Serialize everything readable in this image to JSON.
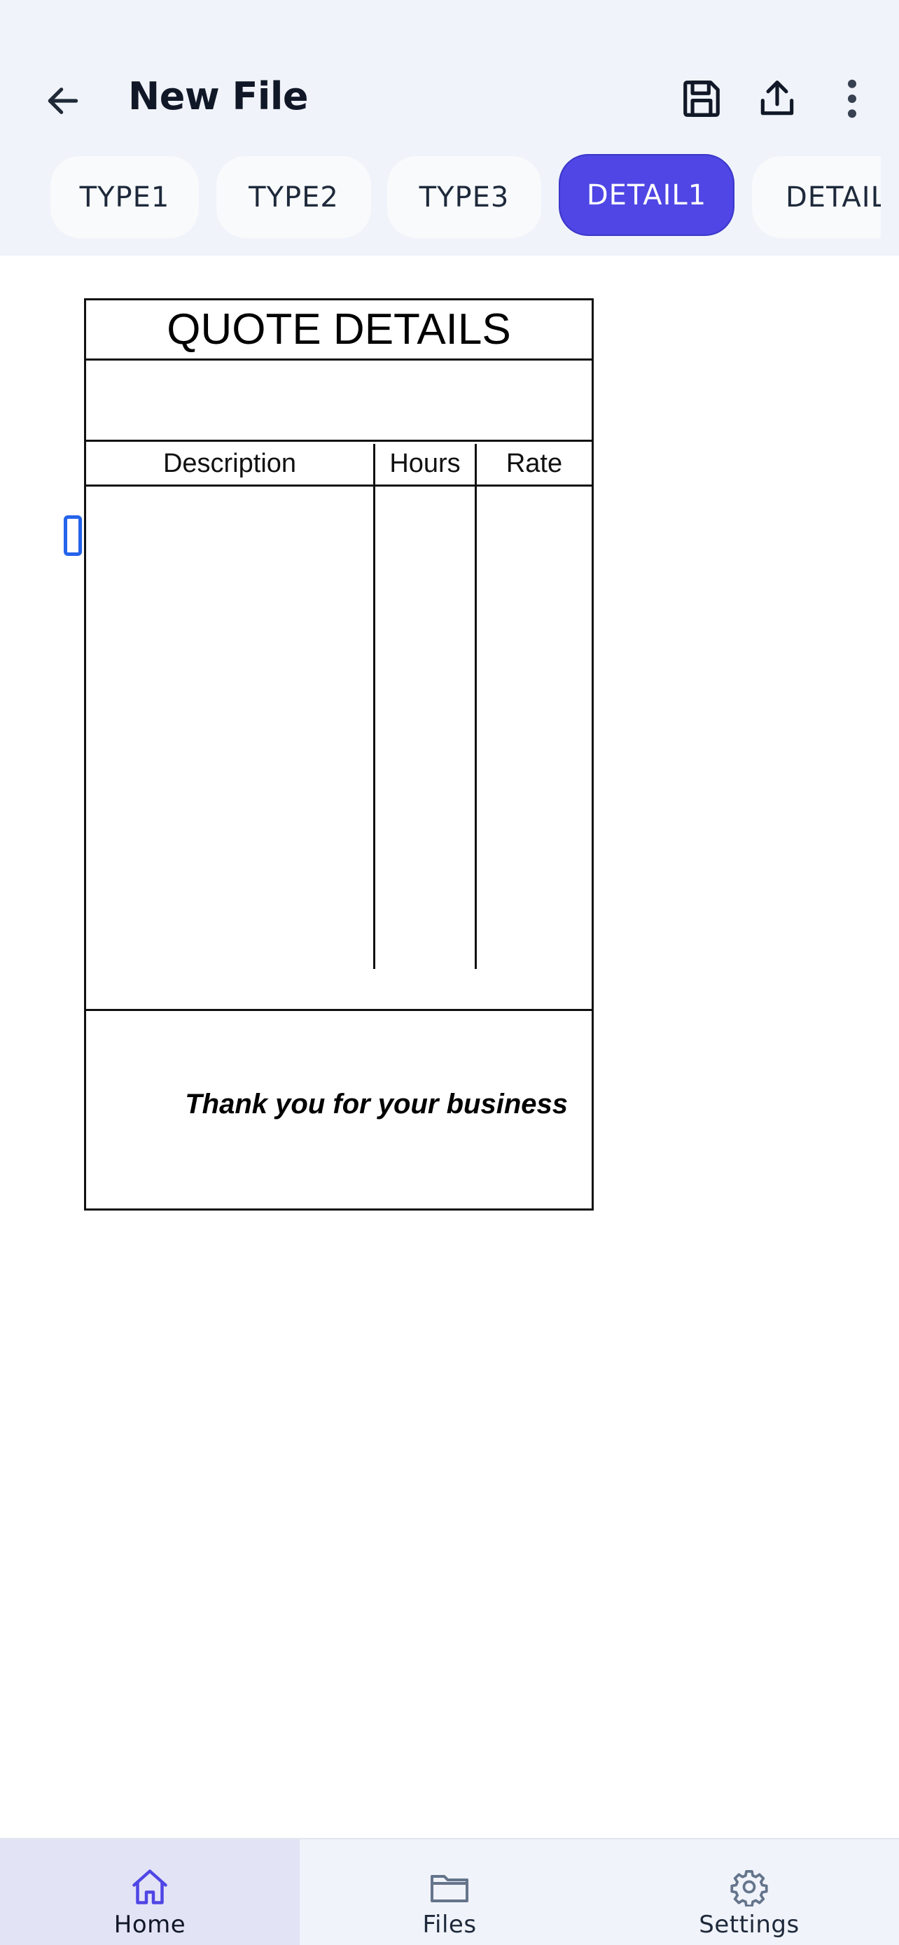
{
  "header": {
    "title": "New File",
    "icons": {
      "back": "arrow-left-icon",
      "save": "floppy-disk-icon",
      "share": "upload-icon",
      "more": "vertical-ellipsis-icon"
    }
  },
  "tabs": [
    {
      "label": "TYPE1",
      "active": false
    },
    {
      "label": "TYPE2",
      "active": false
    },
    {
      "label": "TYPE3",
      "active": false
    },
    {
      "label": "DETAIL1",
      "active": true
    },
    {
      "label": "DETAIL",
      "active": false
    }
  ],
  "document": {
    "title": "QUOTE DETAILS",
    "columns": [
      "Description",
      "Hours",
      "Rate"
    ],
    "footer_note": "Thank you for your business"
  },
  "bottom_nav": [
    {
      "label": "Home",
      "icon": "home-icon",
      "active": true
    },
    {
      "label": "Files",
      "icon": "folder-icon",
      "active": false
    },
    {
      "label": "Settings",
      "icon": "gear-icon",
      "active": false
    }
  ],
  "colors": {
    "accent": "#4f46e5",
    "header_bg": "#f0f3f9",
    "active_nav_bg": "#e3e3f6",
    "cursor": "#2563eb"
  }
}
